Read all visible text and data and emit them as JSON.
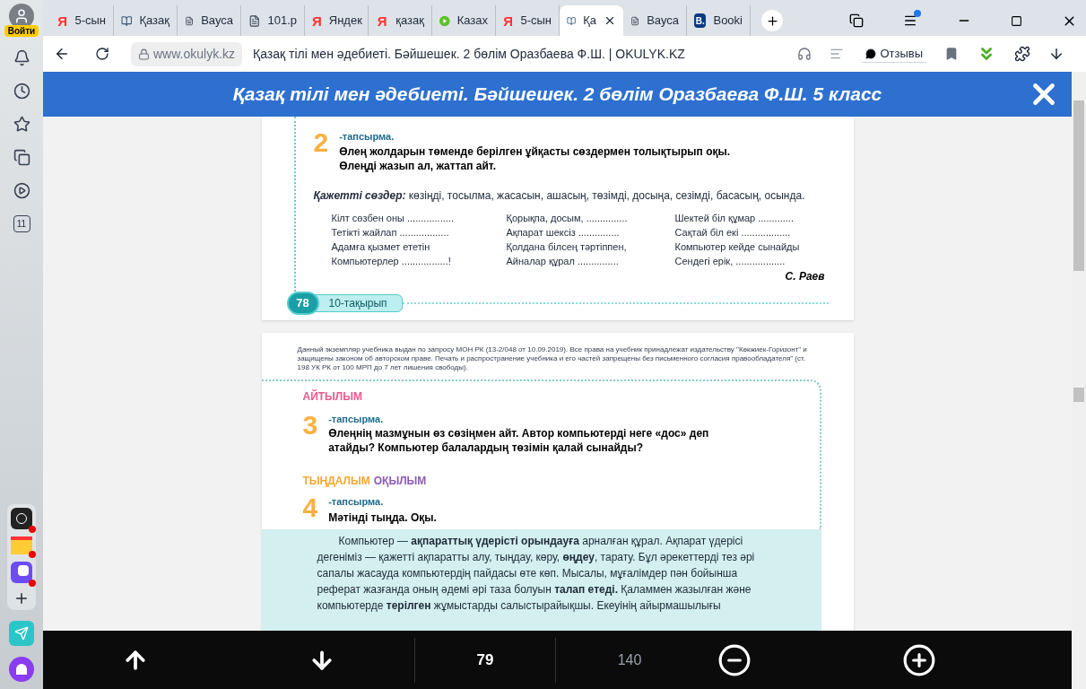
{
  "sidebar": {
    "login": "Войти",
    "counter": "11"
  },
  "tabs": [
    {
      "kind": "yandex",
      "glyph": "Я",
      "title": "5-сын",
      "selected": false
    },
    {
      "kind": "book",
      "title": "Қазақ",
      "selected": false
    },
    {
      "kind": "doc",
      "title": "Вауса",
      "selected": false
    },
    {
      "kind": "doc",
      "title": "101.р",
      "selected": false
    },
    {
      "kind": "yandex",
      "glyph": "Я",
      "title": "Яндек",
      "selected": false
    },
    {
      "kind": "yandex",
      "glyph": "Я",
      "title": "қазақ",
      "selected": false
    },
    {
      "kind": "play",
      "title": "Казах",
      "selected": false
    },
    {
      "kind": "yandex",
      "glyph": "Я",
      "title": "5-сын",
      "selected": false
    },
    {
      "kind": "book",
      "title": "Қа",
      "selected": true
    },
    {
      "kind": "doc",
      "title": "Вауса",
      "selected": false
    },
    {
      "kind": "letter",
      "glyph": "B.",
      "title": "Booki",
      "selected": false
    }
  ],
  "address": {
    "domain": "www.okulyk.kz",
    "title": "Қазақ тілі мен әдебиеті. Бәйшешек. 2 бөлім Оразбаева Ф.Ш. | OKULYK.KZ",
    "feedback": "Отзывы"
  },
  "header": {
    "title": "Қазақ тілі мен әдебиеті. Бәйшешек. 2 бөлім Оразбаева Ф.Ш. 5 класс"
  },
  "page_top": {
    "task_number": "2",
    "task_label": "-тапсырма.",
    "task_text": "Өлең жолдарын төменде берілген ұйқасты сөздермен толықтырып оқы. Өлеңді жазып ал, жаттап айт.",
    "needed_label": "Қажетті сөздер:",
    "needed_words": "көзіңді,  тосылма, жасасын,  ашасың, төзімді, досыңа, сезімді, басасың, осында.",
    "poem": [
      [
        "Кілт сөзбен оны .................",
        "Қорықпа, досым, ...............",
        "Шектей біл құмар ............."
      ],
      [
        "Тетікті жайлап ..................",
        "Ақпарат шексіз ...............",
        "Сақтай біл екі .................."
      ],
      [
        "Адамға қызмет ететін",
        "Қолдана білсең тәртіппен,",
        "Компьютер кейде сынайды"
      ],
      [
        "Компьютерлер .................!",
        "Айналар құрал ...............",
        "Сендегі ерік, .................."
      ]
    ],
    "author": "С. Раев",
    "page_number": "78",
    "topic": "10-тақырып"
  },
  "page_bottom": {
    "notice": "Данный экземпляр учебника выдан по запросу МОН РК (13-2/048 от 10.09.2019). Все права на учебник принадлежат издательству \"Көкжиек-Горизонт\" и защищены законом об авторском праве. Печать и распространение учебника и его частей запрещены без письменного согласия правообладателя\" (ст. 198 УК РК от 100 МРП до 7 лет лишения свободы).",
    "section": "АЙТЫЛЫМ",
    "task3": {
      "number": "3",
      "label": "-тапсырма.",
      "text": "Өлеңнің мазмұнын өз сөзіңмен айт. Автор компьютерді неге «дос» деп атайды? Компьютер балалардың төзімін  қалай сынайды?"
    },
    "sections": [
      {
        "text": "ТЫҢДАЛЫМ",
        "color": "#f7a833"
      },
      {
        "text": "ОҚЫЛЫМ",
        "color": "#8e5bb5"
      }
    ],
    "task4": {
      "number": "4",
      "label": "-тапсырма.",
      "text": "Мәтінді тыңда. Оқы."
    },
    "reading": "Компьютер — **ақпараттық үдерісті орындауға** арналған құрал. Ақпарат үдерісі дегеніміз — қажетті ақпаратты алу, тыңдау, көру, **өңдеу**, тарату. Бұл әрекеттерді тез әрі сапалы жасауда  компьютердің пайдасы өте көп. Мысалы, мұғалімдер пән бойынша реферат жазғанда оның әдемі әрі таза болуын **талап етеді.** Қаламмен жазылған және компьютерде **терілген** жұмыстарды салыстырайықшы. Екеуінің айырмашылығы"
  },
  "bottom_bar": {
    "current_page": "79",
    "total_pages": "140"
  }
}
